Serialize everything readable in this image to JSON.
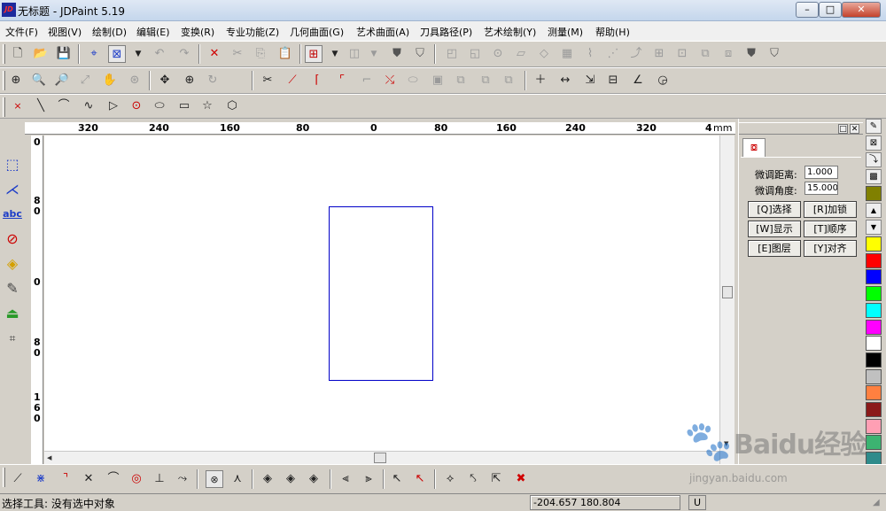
{
  "window": {
    "app_logo": "JD",
    "title": "无标题 - JDPaint 5.19",
    "controls": {
      "minimize": "–",
      "maximize": "□",
      "close": "✕"
    }
  },
  "menubar": {
    "items": [
      "文件(F)",
      "视图(V)",
      "绘制(D)",
      "编辑(E)",
      "变换(R)",
      "专业功能(Z)",
      "几何曲面(G)",
      "艺术曲面(A)",
      "刀具路径(P)",
      "艺术绘制(Y)",
      "测量(M)",
      "帮助(H)"
    ]
  },
  "toolbar1": {
    "icons": [
      "new-file-icon",
      "open-folder-icon",
      "save-icon",
      "crosshair-icon",
      "select-box-icon",
      "dropdown-icon",
      "undo-icon",
      "redo-icon",
      "delete-icon",
      "cut-icon",
      "copy-icon",
      "paste-icon",
      "layers-icon",
      "dropdown-icon",
      "3d-view-icon",
      "dropdown-icon",
      "shield-left-icon",
      "shield-right-icon"
    ]
  },
  "toolbar2": {
    "icons": [
      "zoom-window-icon",
      "zoom-in-icon",
      "zoom-out-icon",
      "zoom-all-icon",
      "pan-hand-icon",
      "zoom-fit-icon",
      "move-icon",
      "zoom-realtime-icon",
      "redraw-icon",
      "trim-icon",
      "break-icon",
      "fillet-icon",
      "chamfer-icon",
      "extend-icon",
      "join-icon",
      "offset-icon",
      "array-icon",
      "dimension-point-icon",
      "dimension-linear-icon",
      "dimension-aligned-icon",
      "dimension-box-icon",
      "dimension-angle-icon",
      "dimension-radius-icon"
    ]
  },
  "toolbar3": {
    "icons": [
      "point-icon",
      "line-icon",
      "arc-icon",
      "spline-icon",
      "polyline-icon",
      "circle-icon",
      "ellipse-icon",
      "rectangle-icon",
      "star-icon",
      "polygon-icon"
    ]
  },
  "ruler": {
    "h_labels": [
      "320",
      "240",
      "160",
      "80",
      "0",
      "80",
      "160",
      "240",
      "320",
      "4"
    ],
    "h_unit": "mm",
    "v_labels": [
      "0",
      "8\n0",
      "0",
      "8\n0",
      "1\n6\n0"
    ]
  },
  "side_panel": {
    "title_buttons": [
      "□",
      "✕"
    ],
    "tab_icon": "node-edit-icon",
    "fine_distance": {
      "label": "微调距离:",
      "value": "1.000"
    },
    "fine_angle": {
      "label": "微调角度:",
      "value": "15.000"
    },
    "buttons": [
      [
        "[Q]选择",
        "[R]加锁"
      ],
      [
        "[W]显示",
        "[T]顺序"
      ],
      [
        "[E]图层",
        "[Y]对齐"
      ]
    ]
  },
  "palette": {
    "colors": [
      "#ffff00",
      "#ff0000",
      "#0000ff",
      "#00ff00",
      "#00ffff",
      "#ff00ff",
      "#ffffff",
      "#000000",
      "#c0c0c0",
      "#ff8040",
      "#8b1a1a",
      "#ff9fb4",
      "#3cb371",
      "#2e8b8b"
    ]
  },
  "status": {
    "text": "选择工具: 没有选中对象",
    "coords": "-204.657 180.804",
    "unit_btn": "U"
  },
  "watermark": {
    "brand": "Baidu经验",
    "url": "jingyan.baidu.com"
  }
}
